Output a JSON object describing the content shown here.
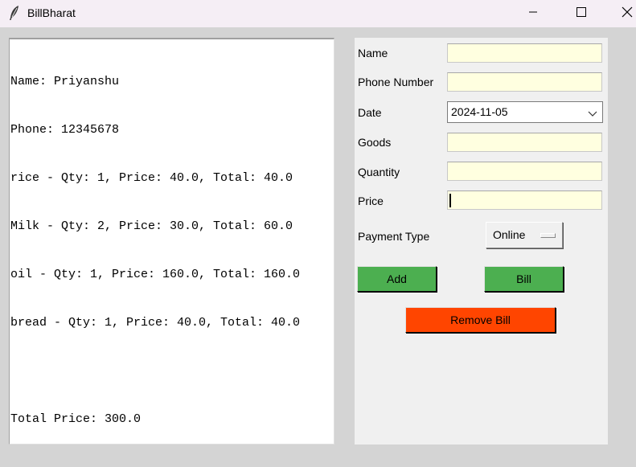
{
  "window": {
    "title": "BillBharat",
    "icon": "feather-icon"
  },
  "bill_output": {
    "lines": [
      "Name: Priyanshu",
      "Phone: 12345678",
      "rice - Qty: 1, Price: 40.0, Total: 40.0",
      "Milk - Qty: 2, Price: 30.0, Total: 60.0",
      "oil - Qty: 1, Price: 160.0, Total: 160.0",
      "bread - Qty: 1, Price: 40.0, Total: 40.0",
      "",
      "Total Price: 300.0"
    ]
  },
  "form": {
    "name_label": "Name",
    "name_value": "",
    "phone_label": "Phone Number",
    "phone_value": "",
    "date_label": "Date",
    "date_value": "2024-11-05",
    "goods_label": "Goods",
    "goods_value": "",
    "quantity_label": "Quantity",
    "quantity_value": "",
    "price_label": "Price",
    "price_value": "",
    "payment_label": "Payment Type",
    "payment_value": "Online"
  },
  "buttons": {
    "add_label": "Add",
    "bill_label": "Bill",
    "remove_label": "Remove Bill"
  },
  "colors": {
    "entry_bg": "#ffffe0",
    "green_button": "#4caf50",
    "remove_button": "#ff4500",
    "panel_bg": "#f0f0f0",
    "window_bg": "#d4d4d4"
  }
}
